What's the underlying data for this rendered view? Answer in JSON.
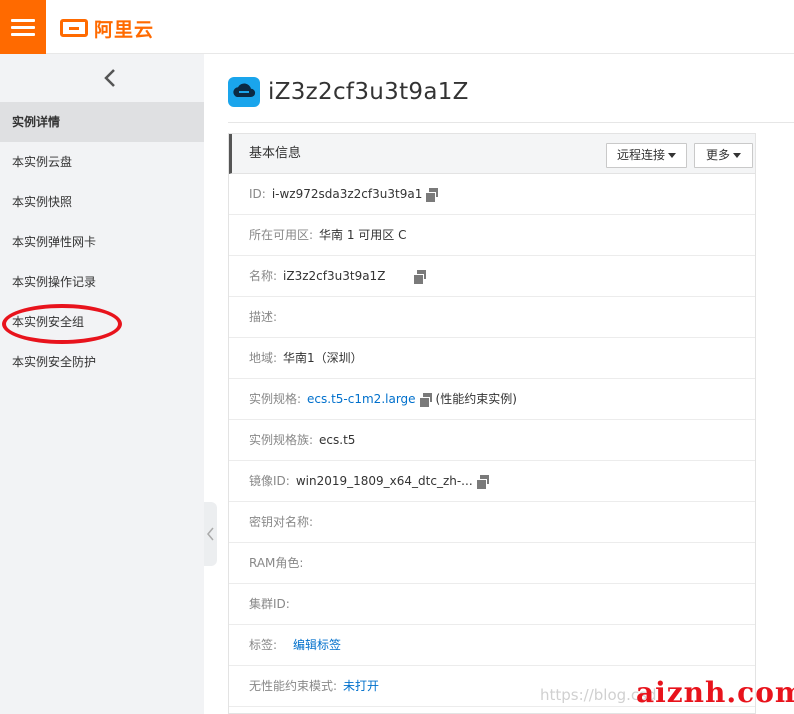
{
  "header": {
    "brand": "阿里云",
    "accent_color": "#ff6a00"
  },
  "sidebar": {
    "back_icon": "chevron-left-icon",
    "items": [
      {
        "label": "实例详情",
        "active": true
      },
      {
        "label": "本实例云盘"
      },
      {
        "label": "本实例快照"
      },
      {
        "label": "本实例弹性网卡"
      },
      {
        "label": "本实例操作记录"
      },
      {
        "label": "本实例安全组"
      },
      {
        "label": "本实例安全防护"
      }
    ]
  },
  "main": {
    "title": "iZ3z2cf3u3t9a1Z",
    "title_icon": "cloud-server-icon",
    "panel": {
      "title": "基本信息",
      "remote_btn": "远程连接",
      "more_btn": "更多",
      "rows": [
        {
          "label": "ID:",
          "value": "i-wz972sda3z2cf3u3t9a1"
        },
        {
          "label": "所在可用区:",
          "value": "华南 1 可用区 C"
        },
        {
          "label": "名称:",
          "value": "iZ3z2cf3u3t9a1Z"
        },
        {
          "label": "描述:",
          "value": ""
        },
        {
          "label": "地域:",
          "value": "华南1（深圳）"
        },
        {
          "label": "实例规格:",
          "value": "ecs.t5-c1m2.large",
          "suffix": "(性能约束实例)"
        },
        {
          "label": "实例规格族:",
          "value": "ecs.t5"
        },
        {
          "label": "镜像ID:",
          "value": "win2019_1809_x64_dtc_zh-..."
        },
        {
          "label": "密钥对名称:",
          "value": ""
        },
        {
          "label": "RAM角色:",
          "value": ""
        },
        {
          "label": "集群ID:",
          "value": ""
        },
        {
          "label": "标签:",
          "value": "编辑标签"
        },
        {
          "label": "无性能约束模式:",
          "value": "未打开"
        }
      ]
    }
  },
  "watermark": {
    "url": "https://blog.csd",
    "site": "aiznh.com"
  }
}
